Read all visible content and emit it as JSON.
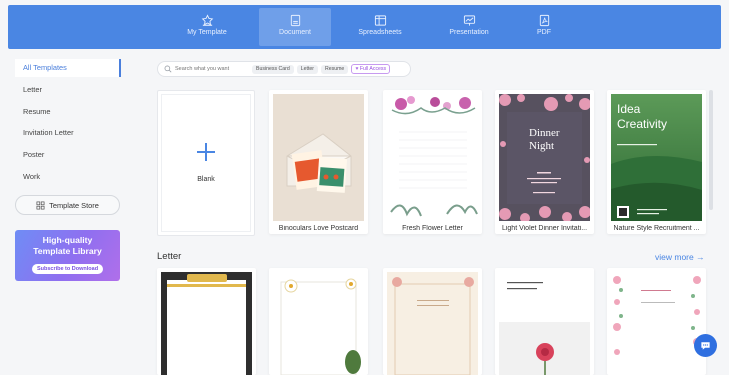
{
  "nav": {
    "tabs": [
      {
        "label": "My Template",
        "icon": "star-template-icon"
      },
      {
        "label": "Document",
        "icon": "document-icon"
      },
      {
        "label": "Spreadsheets",
        "icon": "spreadsheet-icon"
      },
      {
        "label": "Presentation",
        "icon": "presentation-icon"
      },
      {
        "label": "PDF",
        "icon": "pdf-icon"
      }
    ],
    "active_tab": "Document"
  },
  "sidebar": {
    "items": [
      {
        "label": "All Templates"
      },
      {
        "label": "Letter"
      },
      {
        "label": "Resume"
      },
      {
        "label": "Invitation Letter"
      },
      {
        "label": "Poster"
      },
      {
        "label": "Work"
      }
    ],
    "store_label": "Template Store",
    "promo": {
      "line1": "High-quality",
      "line2": "Template Library",
      "button": "Subscribe to Download"
    }
  },
  "search": {
    "placeholder": "Search what you want",
    "chips": [
      "Business Card",
      "Letter",
      "Resume"
    ],
    "pro_chip": "Full Access"
  },
  "blank": {
    "label": "Blank"
  },
  "templates": [
    {
      "name": "Binoculars Love Postcard",
      "card_text": "WE MADE"
    },
    {
      "name": "Fresh Flower Letter"
    },
    {
      "name": "Light Violet Dinner Invitati...",
      "line1": "Dinner",
      "line2": "Night"
    },
    {
      "name": "Nature Style Recruitment ...",
      "line1": "Idea",
      "line2": "Creativity"
    }
  ],
  "letter_section": {
    "title": "Letter",
    "view_more": "view more"
  },
  "colors": {
    "accent": "#4a86e3",
    "nav_bg": "#4a86e3",
    "promo_purple": "#8f6ff0"
  }
}
